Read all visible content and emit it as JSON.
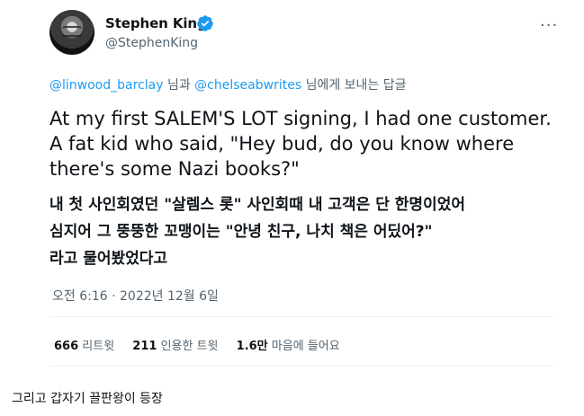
{
  "tweet": {
    "author_name": "Stephen King",
    "author_handle": "@StephenKing",
    "more_label": "···",
    "reply_to_1": "@linwood_barclay",
    "reply_conn": " 님과 ",
    "reply_to_2": "@chelseabwrites",
    "reply_suffix": " 님에게 보내는 답글",
    "text_line1": "At my first SALEM'S LOT signing, I had one customer.",
    "text_line2": "A fat kid who said, \"Hey bud, do you know where",
    "text_line3": "there's some Nazi books?\"",
    "kr_line1": "내 첫 사인회였던 \"살렘스 롯\" 사인회때 내 고객은 단 한명이었어",
    "kr_line2": "심지어 그 뚱뚱한 꼬맹이는 \"안녕 친구, 나치 책은 어딨어?\"",
    "kr_line3": "라고 물어봤었다고",
    "timestamp": "오전 6:16 · 2022년 12월 6일",
    "stats": {
      "retweets_count": "666",
      "retweets_label": " 리트윗",
      "quotes_count": "211",
      "quotes_label": " 인용한 트윗",
      "likes_count": "1.6만",
      "likes_label": " 마음에 들어요"
    },
    "verified_color": "#1d9bf0",
    "link_color": "#1d9bf0"
  },
  "caption": "그리고 갑자기 끌판왕이 등장"
}
